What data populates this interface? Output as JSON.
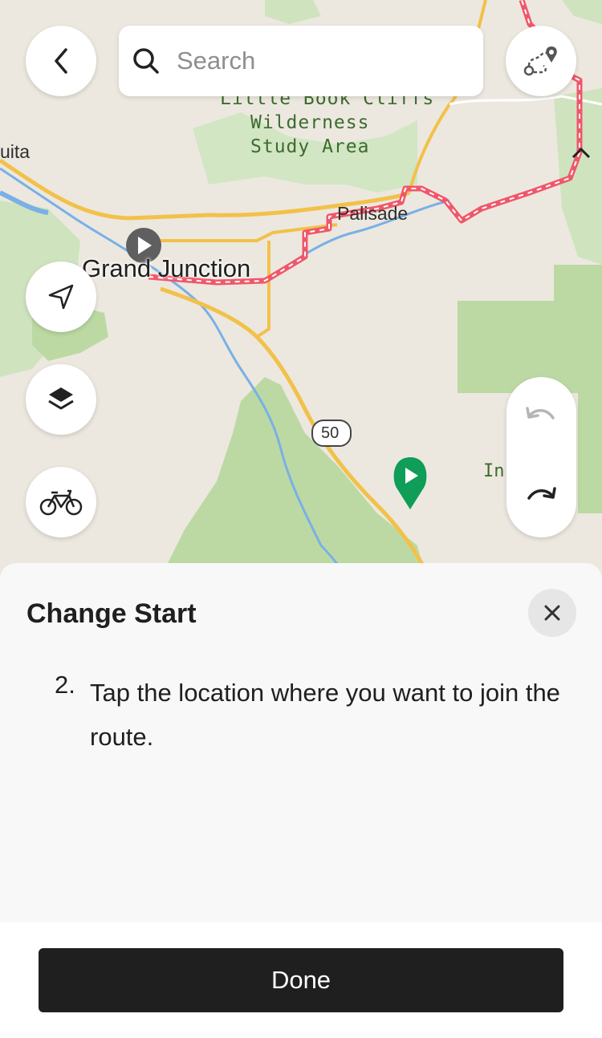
{
  "map": {
    "labels": {
      "wilderness_line1": "Little Book Cliffs",
      "wilderness_line2": "Wilderness",
      "wilderness_line3": "Study Area",
      "west_town_fragment": "uita",
      "palisade": "Palisade",
      "grand_junction": "Grand Junction",
      "highway_shield": "50",
      "right_edge_fragment": "In        oint"
    }
  },
  "header": {
    "back_icon": "chevron-left-icon",
    "search": {
      "placeholder": "Search",
      "value": ""
    },
    "route_tool_icon": "route-waypoint-icon"
  },
  "controls": {
    "locate_icon": "navigation-arrow-icon",
    "layers_icon": "layers-icon",
    "activity_icon": "bicycle-icon",
    "undo_icon": "undo-icon",
    "redo_icon": "redo-icon"
  },
  "colors": {
    "route": "#f0576a",
    "start_marker": "#0f9d58",
    "park_green": "#bcd9a3",
    "road_yellow": "#f2c14a",
    "water_blue": "#7ab0e6"
  },
  "sheet": {
    "title": "Change Start",
    "step_number": "2.",
    "step_text": "Tap the location where you want to join the route."
  },
  "footer": {
    "done_label": "Done"
  }
}
